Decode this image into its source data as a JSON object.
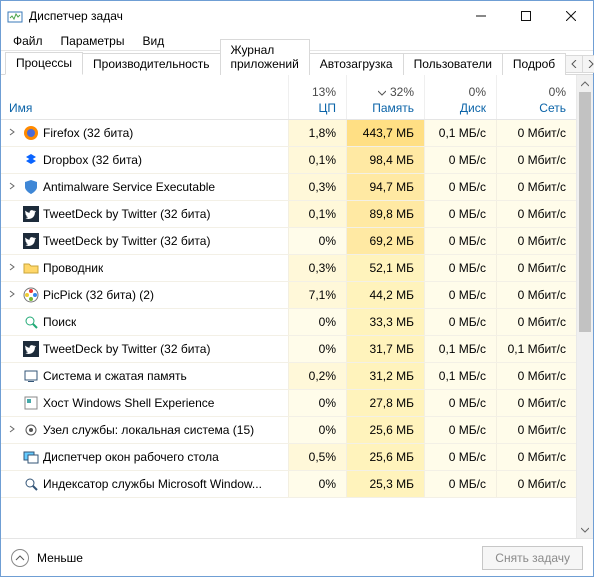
{
  "window": {
    "title": "Диспетчер задач"
  },
  "menu": {
    "file": "Файл",
    "options": "Параметры",
    "view": "Вид"
  },
  "tabs": {
    "processes": "Процессы",
    "performance": "Производительность",
    "app_history": "Журнал приложений",
    "startup": "Автозагрузка",
    "users": "Пользователи",
    "details": "Подроб"
  },
  "columns": {
    "name": "Имя",
    "cpu": {
      "pct": "13%",
      "label": "ЦП"
    },
    "mem": {
      "pct": "32%",
      "label": "Память"
    },
    "disk": {
      "pct": "0%",
      "label": "Диск"
    },
    "net": {
      "pct": "0%",
      "label": "Сеть"
    }
  },
  "rows": [
    {
      "exp": true,
      "icon": "firefox",
      "name": "Firefox (32 бита)",
      "cpu": "1,8%",
      "mem": "443,7 МБ",
      "disk": "0,1 МБ/с",
      "net": "0 Мбит/с",
      "memHeat": 3
    },
    {
      "exp": false,
      "icon": "dropbox",
      "name": "Dropbox (32 бита)",
      "cpu": "0,1%",
      "mem": "98,4 МБ",
      "disk": "0 МБ/с",
      "net": "0 Мбит/с",
      "memHeat": 2
    },
    {
      "exp": true,
      "icon": "shield",
      "name": "Antimalware Service Executable",
      "cpu": "0,3%",
      "mem": "94,7 МБ",
      "disk": "0 МБ/с",
      "net": "0 Мбит/с",
      "memHeat": 2
    },
    {
      "exp": false,
      "icon": "tweet",
      "name": "TweetDeck by Twitter (32 бита)",
      "cpu": "0,1%",
      "mem": "89,8 МБ",
      "disk": "0 МБ/с",
      "net": "0 Мбит/с",
      "memHeat": 2
    },
    {
      "exp": false,
      "icon": "tweet",
      "name": "TweetDeck by Twitter (32 бита)",
      "cpu": "0%",
      "mem": "69,2 МБ",
      "disk": "0 МБ/с",
      "net": "0 Мбит/с",
      "memHeat": 2
    },
    {
      "exp": true,
      "icon": "folder",
      "name": "Проводник",
      "cpu": "0,3%",
      "mem": "52,1 МБ",
      "disk": "0 МБ/с",
      "net": "0 Мбит/с",
      "memHeat": 1
    },
    {
      "exp": true,
      "icon": "picpick",
      "name": "PicPick (32 бита) (2)",
      "cpu": "7,1%",
      "mem": "44,2 МБ",
      "disk": "0 МБ/с",
      "net": "0 Мбит/с",
      "memHeat": 1
    },
    {
      "exp": false,
      "icon": "search",
      "name": "Поиск",
      "cpu": "0%",
      "mem": "33,3 МБ",
      "disk": "0 МБ/с",
      "net": "0 Мбит/с",
      "memHeat": 1
    },
    {
      "exp": false,
      "icon": "tweet",
      "name": "TweetDeck by Twitter (32 бита)",
      "cpu": "0%",
      "mem": "31,7 МБ",
      "disk": "0,1 МБ/с",
      "net": "0,1 Мбит/с",
      "memHeat": 1
    },
    {
      "exp": false,
      "icon": "system",
      "name": "Система и сжатая память",
      "cpu": "0,2%",
      "mem": "31,2 МБ",
      "disk": "0,1 МБ/с",
      "net": "0 Мбит/с",
      "memHeat": 1
    },
    {
      "exp": false,
      "icon": "host",
      "name": "Хост Windows Shell Experience",
      "cpu": "0%",
      "mem": "27,8 МБ",
      "disk": "0 МБ/с",
      "net": "0 Мбит/с",
      "memHeat": 1
    },
    {
      "exp": true,
      "icon": "gear",
      "name": "Узел службы: локальная система (15)",
      "cpu": "0%",
      "mem": "25,6 МБ",
      "disk": "0 МБ/с",
      "net": "0 Мбит/с",
      "memHeat": 1
    },
    {
      "exp": false,
      "icon": "dwm",
      "name": "Диспетчер окон рабочего стола",
      "cpu": "0,5%",
      "mem": "25,6 МБ",
      "disk": "0 МБ/с",
      "net": "0 Мбит/с",
      "memHeat": 1
    },
    {
      "exp": false,
      "icon": "index",
      "name": "Индексатор службы Microsoft Window...",
      "cpu": "0%",
      "mem": "25,3 МБ",
      "disk": "0 МБ/с",
      "net": "0 Мбит/с",
      "memHeat": 1
    }
  ],
  "footer": {
    "fewer": "Меньше",
    "end_task": "Снять задачу"
  }
}
